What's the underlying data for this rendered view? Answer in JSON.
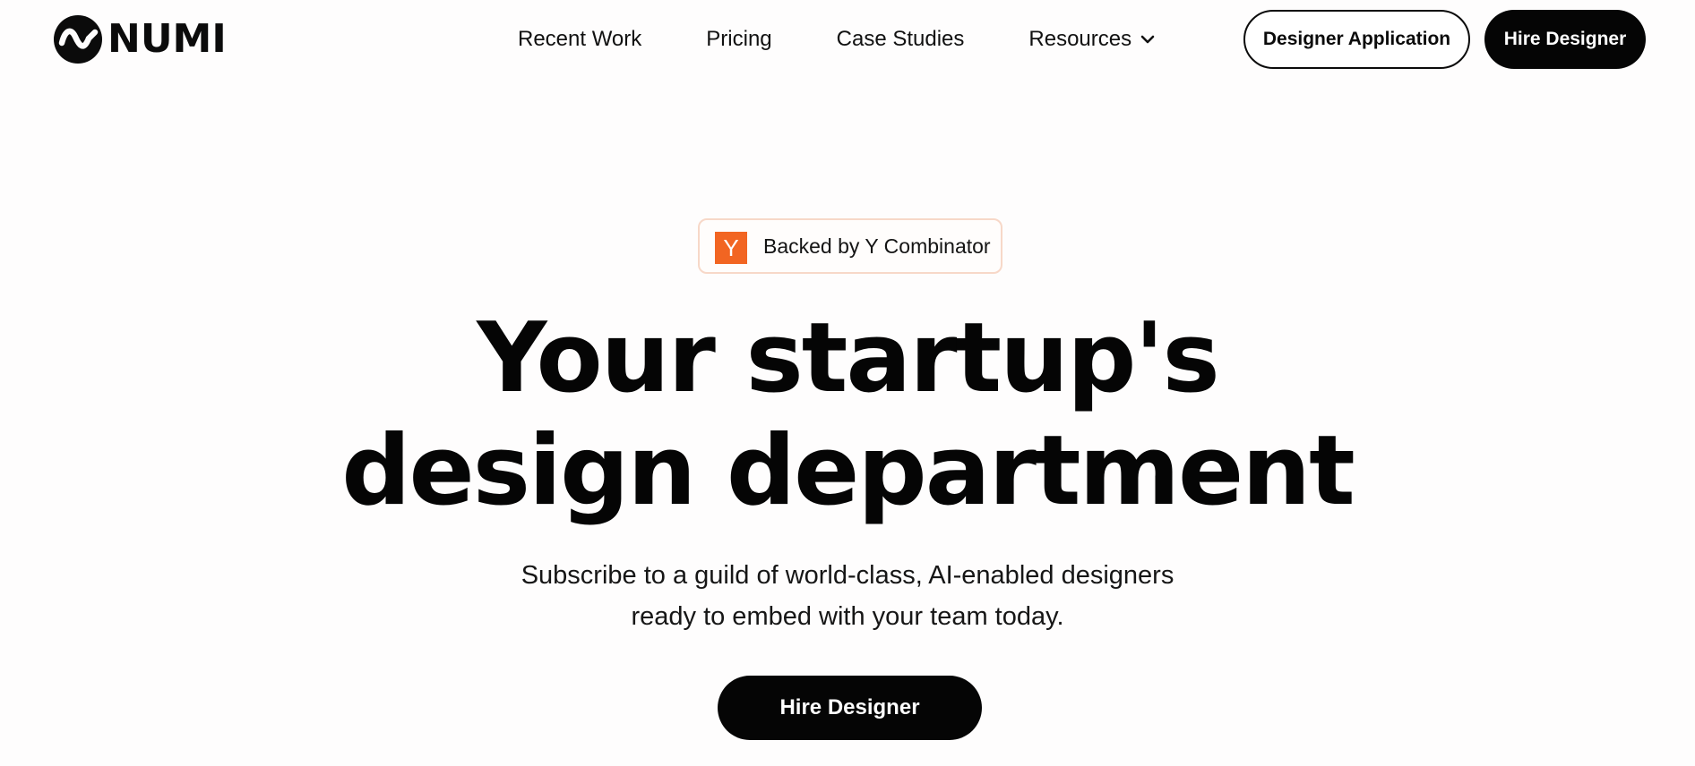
{
  "brand": {
    "name": "NUMI",
    "logo_icon": "numi-wave-logo-icon"
  },
  "nav": {
    "items": [
      {
        "label": "Recent Work"
      },
      {
        "label": "Pricing"
      },
      {
        "label": "Case Studies"
      },
      {
        "label": "Resources",
        "icon": "chevron-down-icon"
      }
    ]
  },
  "header_buttons": {
    "designer_application": "Designer Application",
    "hire_designer": "Hire Designer"
  },
  "badge": {
    "icon_letter": "Y",
    "icon_color": "#f26522",
    "text": "Backed by Y Combinator"
  },
  "hero": {
    "headline_line1": "Your startup's",
    "headline_line2": "design department",
    "subtitle_line1": "Subscribe to a guild of world-class, AI-enabled designers",
    "subtitle_line2": "ready to embed with your team today.",
    "cta": "Hire Designer"
  },
  "colors": {
    "primary": "#050505",
    "background": "#fefdfd",
    "accent": "#f26522"
  }
}
